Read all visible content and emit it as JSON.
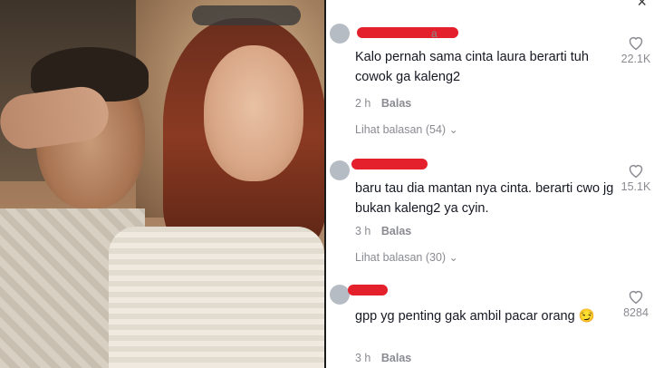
{
  "close_icon_glyph": "×",
  "comments": [
    {
      "username_visible": "a",
      "text": "Kalo pernah sama cinta laura berarti tuh cowok ga kaleng2",
      "time": "2 h",
      "reply_label": "Balas",
      "replies_label": "Lihat balasan (54)",
      "likes": "22.1K"
    },
    {
      "text": "baru tau dia mantan nya cinta. berarti cwo jg bukan kaleng2 ya cyin.",
      "time": "3 h",
      "reply_label": "Balas",
      "replies_label": "Lihat balasan (30)",
      "likes": "15.1K"
    },
    {
      "text": "gpp yg penting gak ambil pacar orang 😏",
      "time": "3 h",
      "reply_label": "Balas",
      "likes": "8284"
    }
  ],
  "colors": {
    "redaction": "#e3202b",
    "text": "#161823",
    "muted": "#8a8b91"
  }
}
